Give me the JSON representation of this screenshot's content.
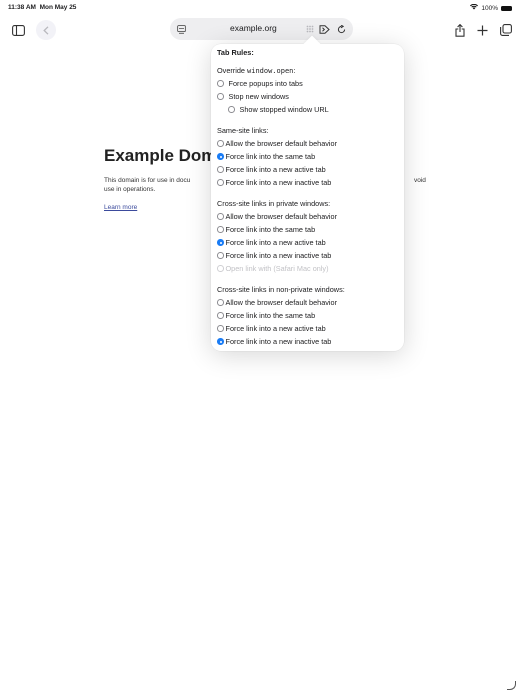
{
  "status": {
    "time": "11:38 AM",
    "date": "Mon May 25",
    "battery": "100%"
  },
  "address": {
    "url": "example.org"
  },
  "page": {
    "heading": "Example Doma",
    "paragraph_left": "This domain is for use in docu",
    "paragraph_right": "void",
    "paragraph_line2": "use in operations.",
    "link": "Learn more"
  },
  "popover": {
    "title": "Tab Rules:",
    "override": {
      "label_prefix": "Override ",
      "label_code": "window.open",
      "label_suffix": ":",
      "options": [
        "Force popups into tabs",
        "Stop new windows"
      ],
      "sub_option": "Show stopped window URL"
    },
    "same_site": {
      "label": "Same-site links:",
      "options": [
        "Allow the browser default behavior",
        "Force link into the same tab",
        "Force link into a new active tab",
        "Force link into a new inactive tab"
      ],
      "selected": 1
    },
    "cross_private": {
      "label": "Cross-site links in private windows:",
      "options": [
        "Allow the browser default behavior",
        "Force link into the same tab",
        "Force link into a new active tab",
        "Force link into a new inactive tab",
        "Open link with (Safari Mac only)"
      ],
      "selected": 2
    },
    "cross_nonprivate": {
      "label": "Cross-site links in non-private windows:",
      "options": [
        "Allow the browser default behavior",
        "Force link into the same tab",
        "Force link into a new active tab",
        "Force link into a new inactive tab"
      ],
      "selected": 3
    }
  }
}
